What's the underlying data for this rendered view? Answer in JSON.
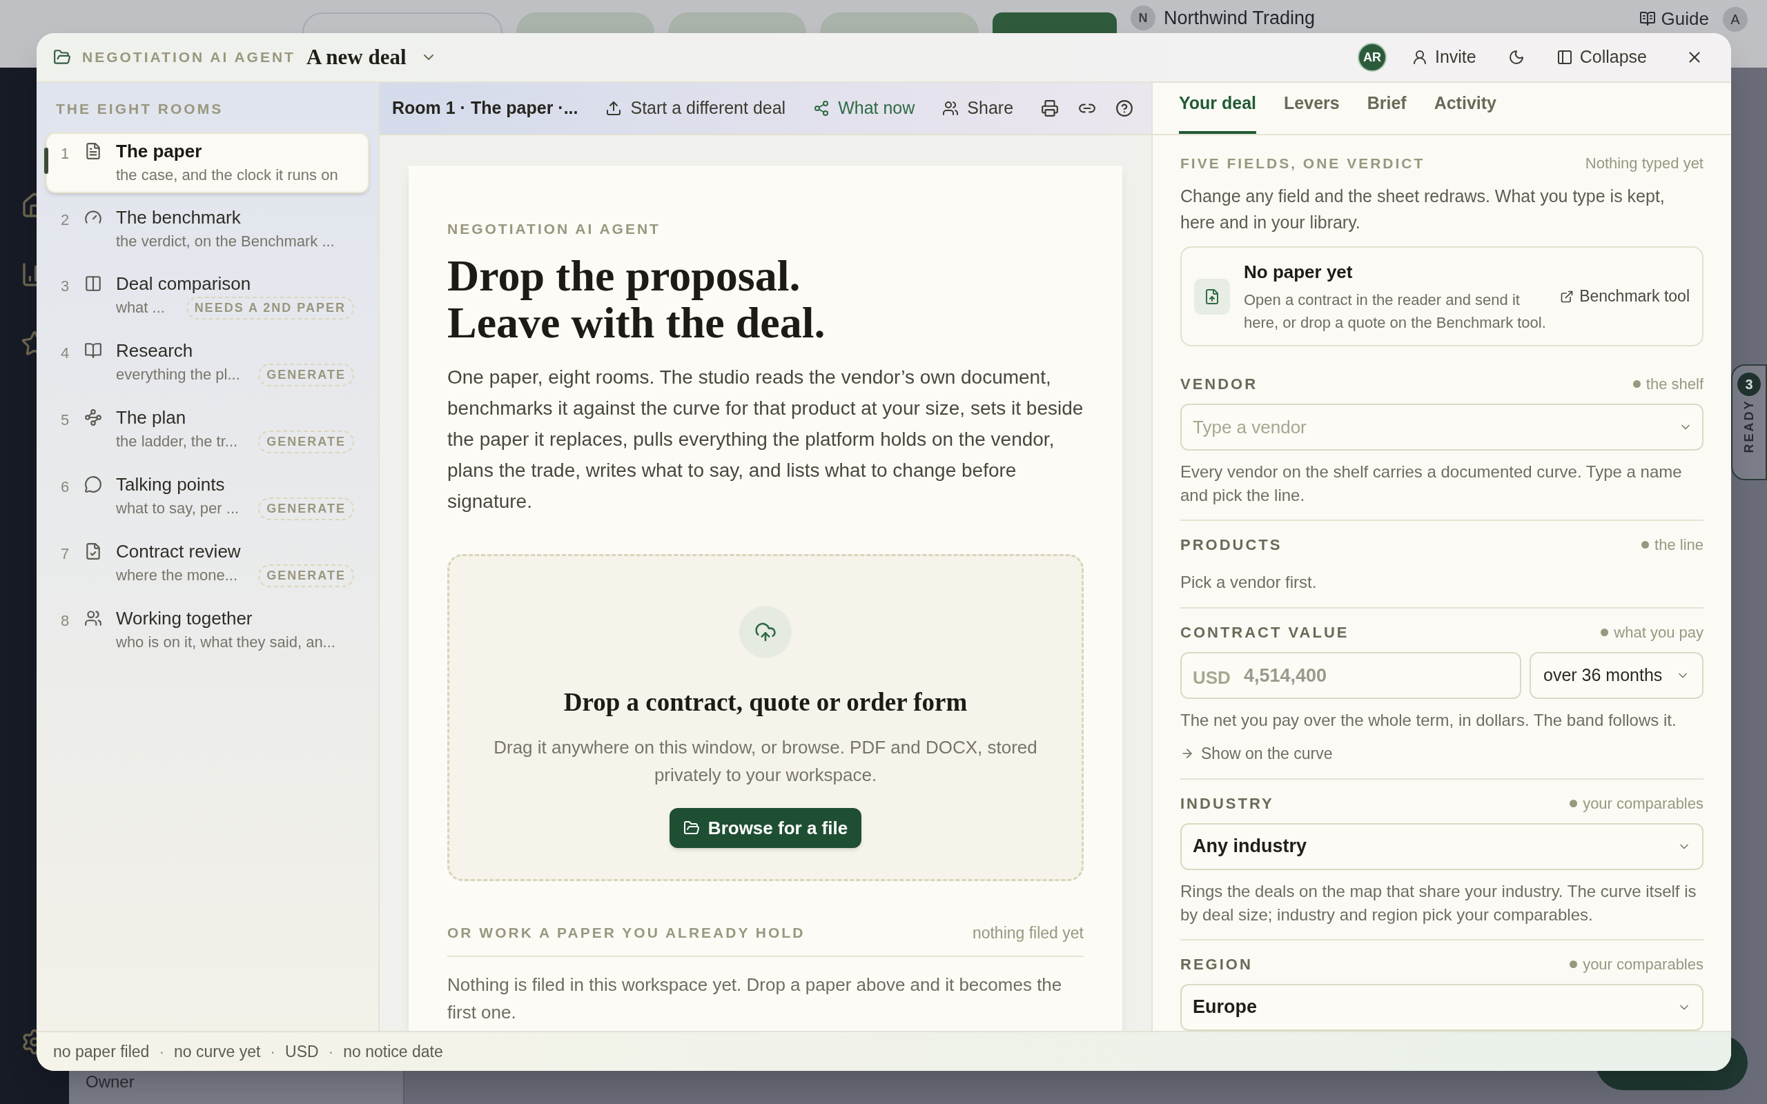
{
  "background": {
    "workspace": {
      "initial": "N",
      "name": "Northwind Trading"
    },
    "guide": "Guide",
    "account": "A",
    "owner": "Owner",
    "ready_tab": {
      "label": "READY",
      "count": "3"
    }
  },
  "window": {
    "eyebrow": "NEGOTIATION AI AGENT",
    "title": "A new deal",
    "avatar": "AR",
    "actions": [
      "Invite",
      "Collapse"
    ]
  },
  "sidebar": {
    "heading": "THE EIGHT ROOMS",
    "items": [
      {
        "number": "1",
        "title": "The paper",
        "subtitle": "the case, and the clock it runs on",
        "selected": true
      },
      {
        "number": "2",
        "title": "The benchmark",
        "subtitle": "the verdict, on the Benchmark ...",
        "selected": false
      },
      {
        "number": "3",
        "title": "Deal comparison",
        "subtitle": "what ...",
        "badge": "NEEDS A 2ND PAPER",
        "selected": false
      },
      {
        "number": "4",
        "title": "Research",
        "subtitle": "everything the pl...",
        "badge": "GENERATE",
        "selected": false
      },
      {
        "number": "5",
        "title": "The plan",
        "subtitle": "the ladder, the tr...",
        "badge": "GENERATE",
        "selected": false
      },
      {
        "number": "6",
        "title": "Talking points",
        "subtitle": "what to say, per ...",
        "badge": "GENERATE",
        "selected": false
      },
      {
        "number": "7",
        "title": "Contract review",
        "subtitle": "where the mone...",
        "badge": "GENERATE",
        "selected": false
      },
      {
        "number": "8",
        "title": "Working together",
        "subtitle": "who is on it, what they said, an...",
        "selected": false
      }
    ]
  },
  "toolbar": {
    "title": "Room 1 · The paper ·...",
    "actions": [
      {
        "label": "Start a different deal",
        "highlight": false
      },
      {
        "label": "What now",
        "highlight": true
      },
      {
        "label": "Share",
        "highlight": false
      }
    ]
  },
  "paper": {
    "eyebrow": "NEGOTIATION AI AGENT",
    "headline": [
      "Drop the proposal.",
      "Leave with the deal."
    ],
    "intro": "One paper, eight rooms. The studio reads the vendor’s own document, benchmarks it against the curve for that product at your size, sets it beside the paper it replaces, pulls everything the platform holds on the vendor, plans the trade, writes what to say, and lists what to change before signature.",
    "dropzone": {
      "title": "Drop a contract, quote or order form",
      "body": "Drag it anywhere on this window, or browse. PDF and DOCX, stored privately to your workspace.",
      "button": "Browse for a file"
    },
    "library": {
      "heading": "OR WORK A PAPER YOU ALREADY HOLD",
      "note": "nothing filed yet",
      "body": "Nothing is filed in this workspace yet. Drop a paper above and it becomes the first one."
    }
  },
  "panel": {
    "tabs": [
      {
        "label": "Your deal",
        "selected": true
      },
      {
        "label": "Levers",
        "selected": false
      },
      {
        "label": "Brief",
        "selected": false
      },
      {
        "label": "Activity",
        "selected": false
      }
    ],
    "heading": "FIVE FIELDS, ONE VERDICT",
    "heading_note": "Nothing typed yet",
    "intro": "Change any field and the sheet redraws. What you type is kept, here and in your library.",
    "notice": {
      "title": "No paper yet",
      "body": "Open a contract in the reader and send it here, or drop a quote on the Benchmark tool.",
      "link": "Benchmark tool"
    },
    "fields": [
      {
        "kind": "combo",
        "label": "VENDOR",
        "hint": "the shelf",
        "placeholder": "Type a vendor",
        "help": "Every vendor on the shelf carries a documented curve. Type a name and pick the line."
      },
      {
        "kind": "text",
        "label": "PRODUCTS",
        "hint": "the line",
        "body": "Pick a vendor first."
      },
      {
        "kind": "money",
        "label": "CONTRACT VALUE",
        "hint": "what you pay",
        "currency": "USD",
        "placeholder": "4,514,400",
        "term": "over 36 months",
        "help": "The net you pay over the whole term, in dollars. The band follows it.",
        "link": "Show on the curve"
      },
      {
        "kind": "select",
        "label": "INDUSTRY",
        "hint": "your comparables",
        "value": "Any industry",
        "help": "Rings the deals on the map that share your industry. The curve itself is by deal size; industry and region pick your comparables."
      },
      {
        "kind": "select",
        "label": "REGION",
        "hint": "your comparables",
        "value": "Europe"
      }
    ]
  },
  "status_bar": [
    "no paper filed",
    "·",
    "no curve yet",
    "·",
    "USD",
    "·",
    "no notice date"
  ]
}
